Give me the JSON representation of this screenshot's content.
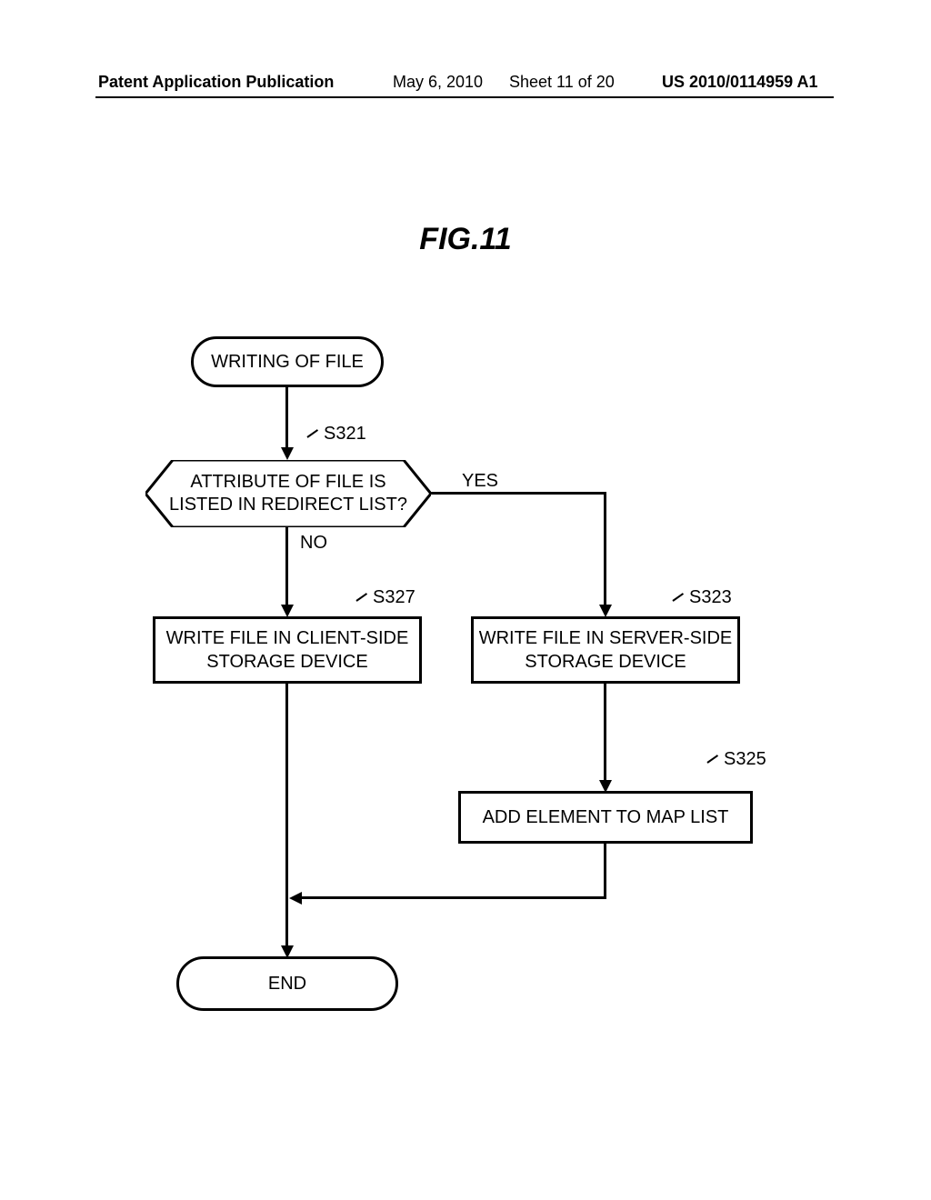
{
  "header": {
    "publication": "Patent Application Publication",
    "date": "May 6, 2010",
    "sheet": "Sheet 11 of 20",
    "pubnum": "US 2010/0114959 A1"
  },
  "figure_title": "FIG.11",
  "flowchart": {
    "start": {
      "label": "WRITING OF FILE"
    },
    "decision": {
      "text": "ATTRIBUTE OF FILE IS\nLISTED IN REDIRECT LIST?",
      "step": "S321",
      "yes": "YES",
      "no": "NO"
    },
    "process_no": {
      "text": "WRITE FILE IN CLIENT-SIDE\nSTORAGE DEVICE",
      "step": "S327"
    },
    "process_yes1": {
      "text": "WRITE FILE IN SERVER-SIDE\nSTORAGE DEVICE",
      "step": "S323"
    },
    "process_yes2": {
      "text": "ADD ELEMENT TO MAP LIST",
      "step": "S325"
    },
    "end": {
      "label": "END"
    }
  }
}
